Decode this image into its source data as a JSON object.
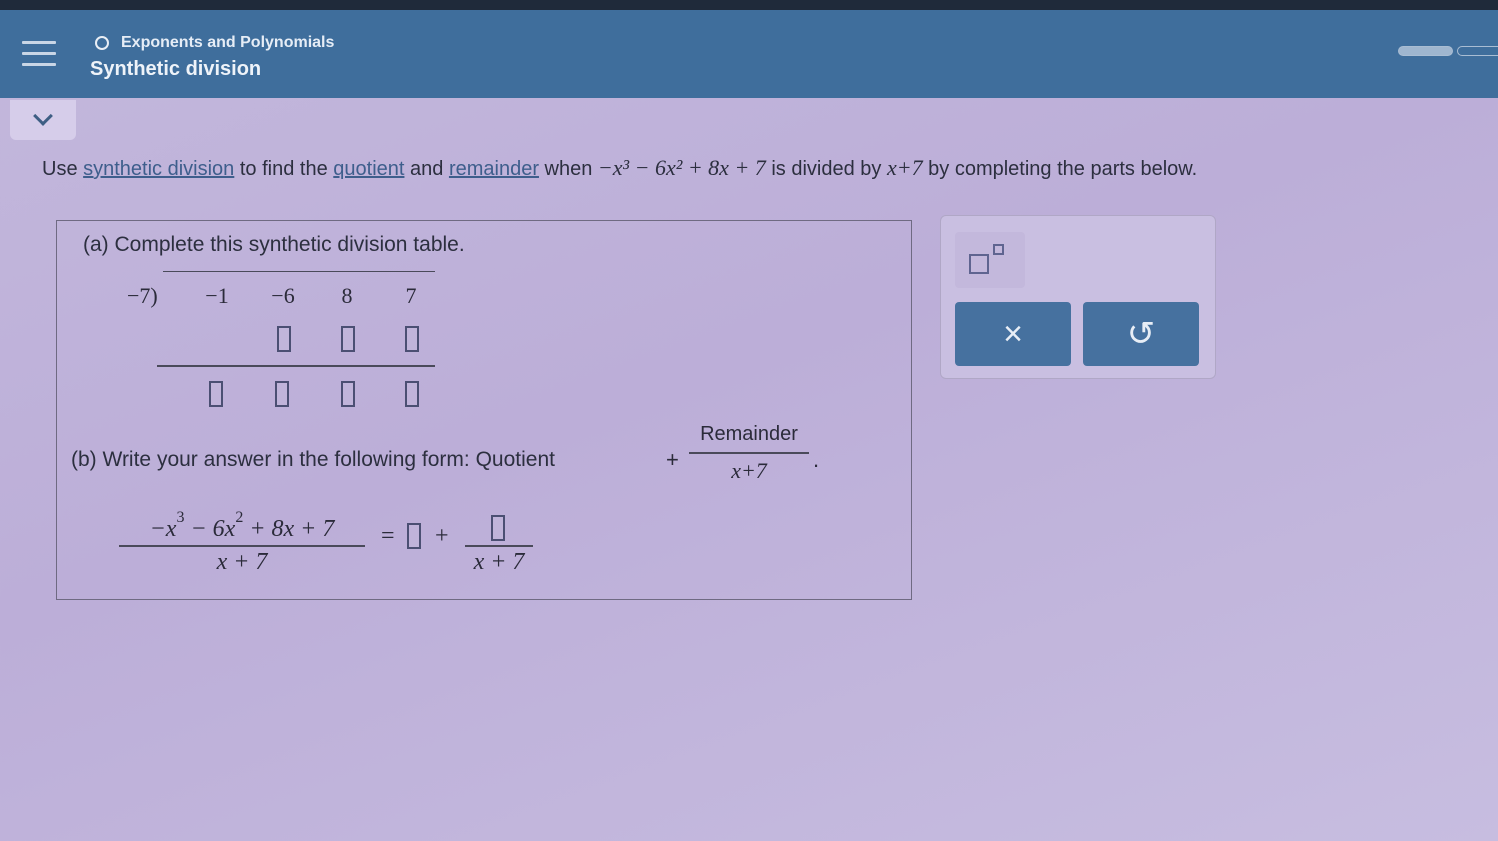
{
  "header": {
    "topic": "Exponents and Polynomials",
    "title": "Synthetic division"
  },
  "instruction": {
    "prefix": "Use ",
    "link1": "synthetic division",
    "mid1": " to find the ",
    "link2": "quotient",
    "mid2": " and ",
    "link3": "remainder",
    "mid3": " when ",
    "poly": "−x³ − 6x² + 8x + 7",
    "mid4": " is divided by ",
    "divisor": "x+7",
    "suffix": " by completing the parts below."
  },
  "part_a": {
    "label": "(a) Complete this synthetic division table.",
    "divisor": "−7)",
    "coefficients": [
      "−1",
      "−6",
      "8",
      "7"
    ]
  },
  "part_b": {
    "label": "(b) Write your answer in the following form: Quotient",
    "plus": "+",
    "frac_numerator": "Remainder",
    "frac_denominator": "x+7",
    "period": "."
  },
  "equation": {
    "numerator_parts": [
      "−x",
      "3",
      " − 6x",
      "2",
      " + 8x + 7"
    ],
    "denominator": "x + 7",
    "equals": "=",
    "plus": "+",
    "small_denominator": "x + 7"
  },
  "toolbox": {
    "exponent_icon": "superscript-icon",
    "clear_label": "×",
    "undo_label": "↺"
  }
}
